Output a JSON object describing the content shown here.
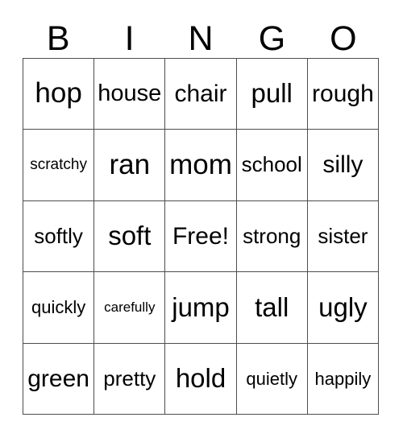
{
  "card": {
    "title_letters": [
      "B",
      "I",
      "N",
      "G",
      "O"
    ],
    "grid_line_color": "#4d4d4d",
    "background_color": "#ffffff",
    "text_color": "#000000",
    "rows": 5,
    "columns": 5,
    "free_space_label": "Free!",
    "cells": [
      [
        "hop",
        "house",
        "chair",
        "pull",
        "rough"
      ],
      [
        "scratchy",
        "ran",
        "mom",
        "school",
        "silly"
      ],
      [
        "softly",
        "soft",
        "Free!",
        "strong",
        "sister"
      ],
      [
        "quickly",
        "carefully",
        "jump",
        "tall",
        "ugly"
      ],
      [
        "green",
        "pretty",
        "hold",
        "quietly",
        "happily"
      ]
    ]
  }
}
